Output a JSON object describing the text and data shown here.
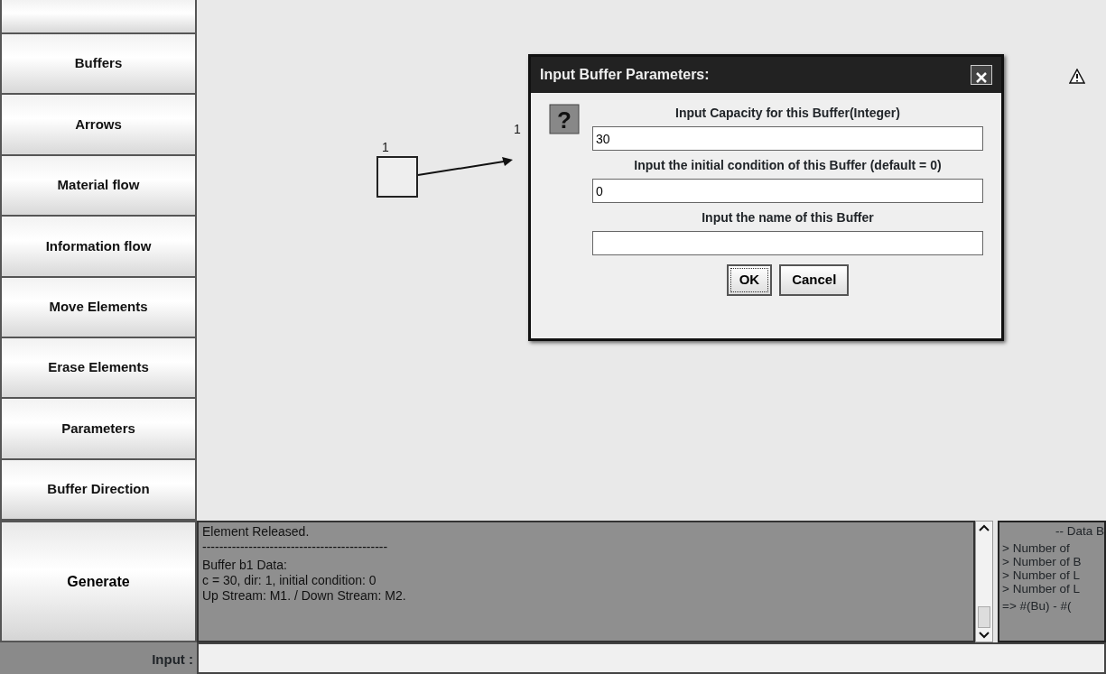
{
  "tool_buttons": [
    {
      "label": "Buffers"
    },
    {
      "label": "Arrows"
    },
    {
      "label": "Material flow"
    },
    {
      "label": "Information flow"
    },
    {
      "label": "Move Elements"
    },
    {
      "label": "Erase Elements"
    },
    {
      "label": "Parameters"
    },
    {
      "label": "Buffer Direction"
    }
  ],
  "generate_button": {
    "label": "Generate"
  },
  "canvas": {
    "nodes": [
      {
        "label": "1"
      }
    ],
    "arrow_label": "1"
  },
  "dialog": {
    "title": "Input Buffer Parameters:",
    "fields": [
      {
        "label": "Input Capacity for this Buffer(Integer)",
        "value": "30"
      },
      {
        "label": "Input the initial condition of this Buffer (default = 0)",
        "value": "0"
      },
      {
        "label": "Input the name of this Buffer"
      }
    ],
    "icon_glyph": "?",
    "buttons": [
      {
        "label": "OK",
        "focused": true
      },
      {
        "label": "Cancel",
        "focused": false
      }
    ]
  },
  "log": {
    "lines": [
      "Element Released.",
      "--------------------------------------------",
      "Buffer b1 Data:",
      "c = 30, dir: 1, initial condition: 0",
      "Up Stream: M1.   /  Down Stream: M2."
    ]
  },
  "data_panel": {
    "title": "-- Data B",
    "lines": [
      "> Number of",
      "> Number of B",
      "> Number of L",
      "> Number of L"
    ],
    "formula": "=> #(Bu) - #("
  },
  "input": {
    "label": "Input :"
  }
}
